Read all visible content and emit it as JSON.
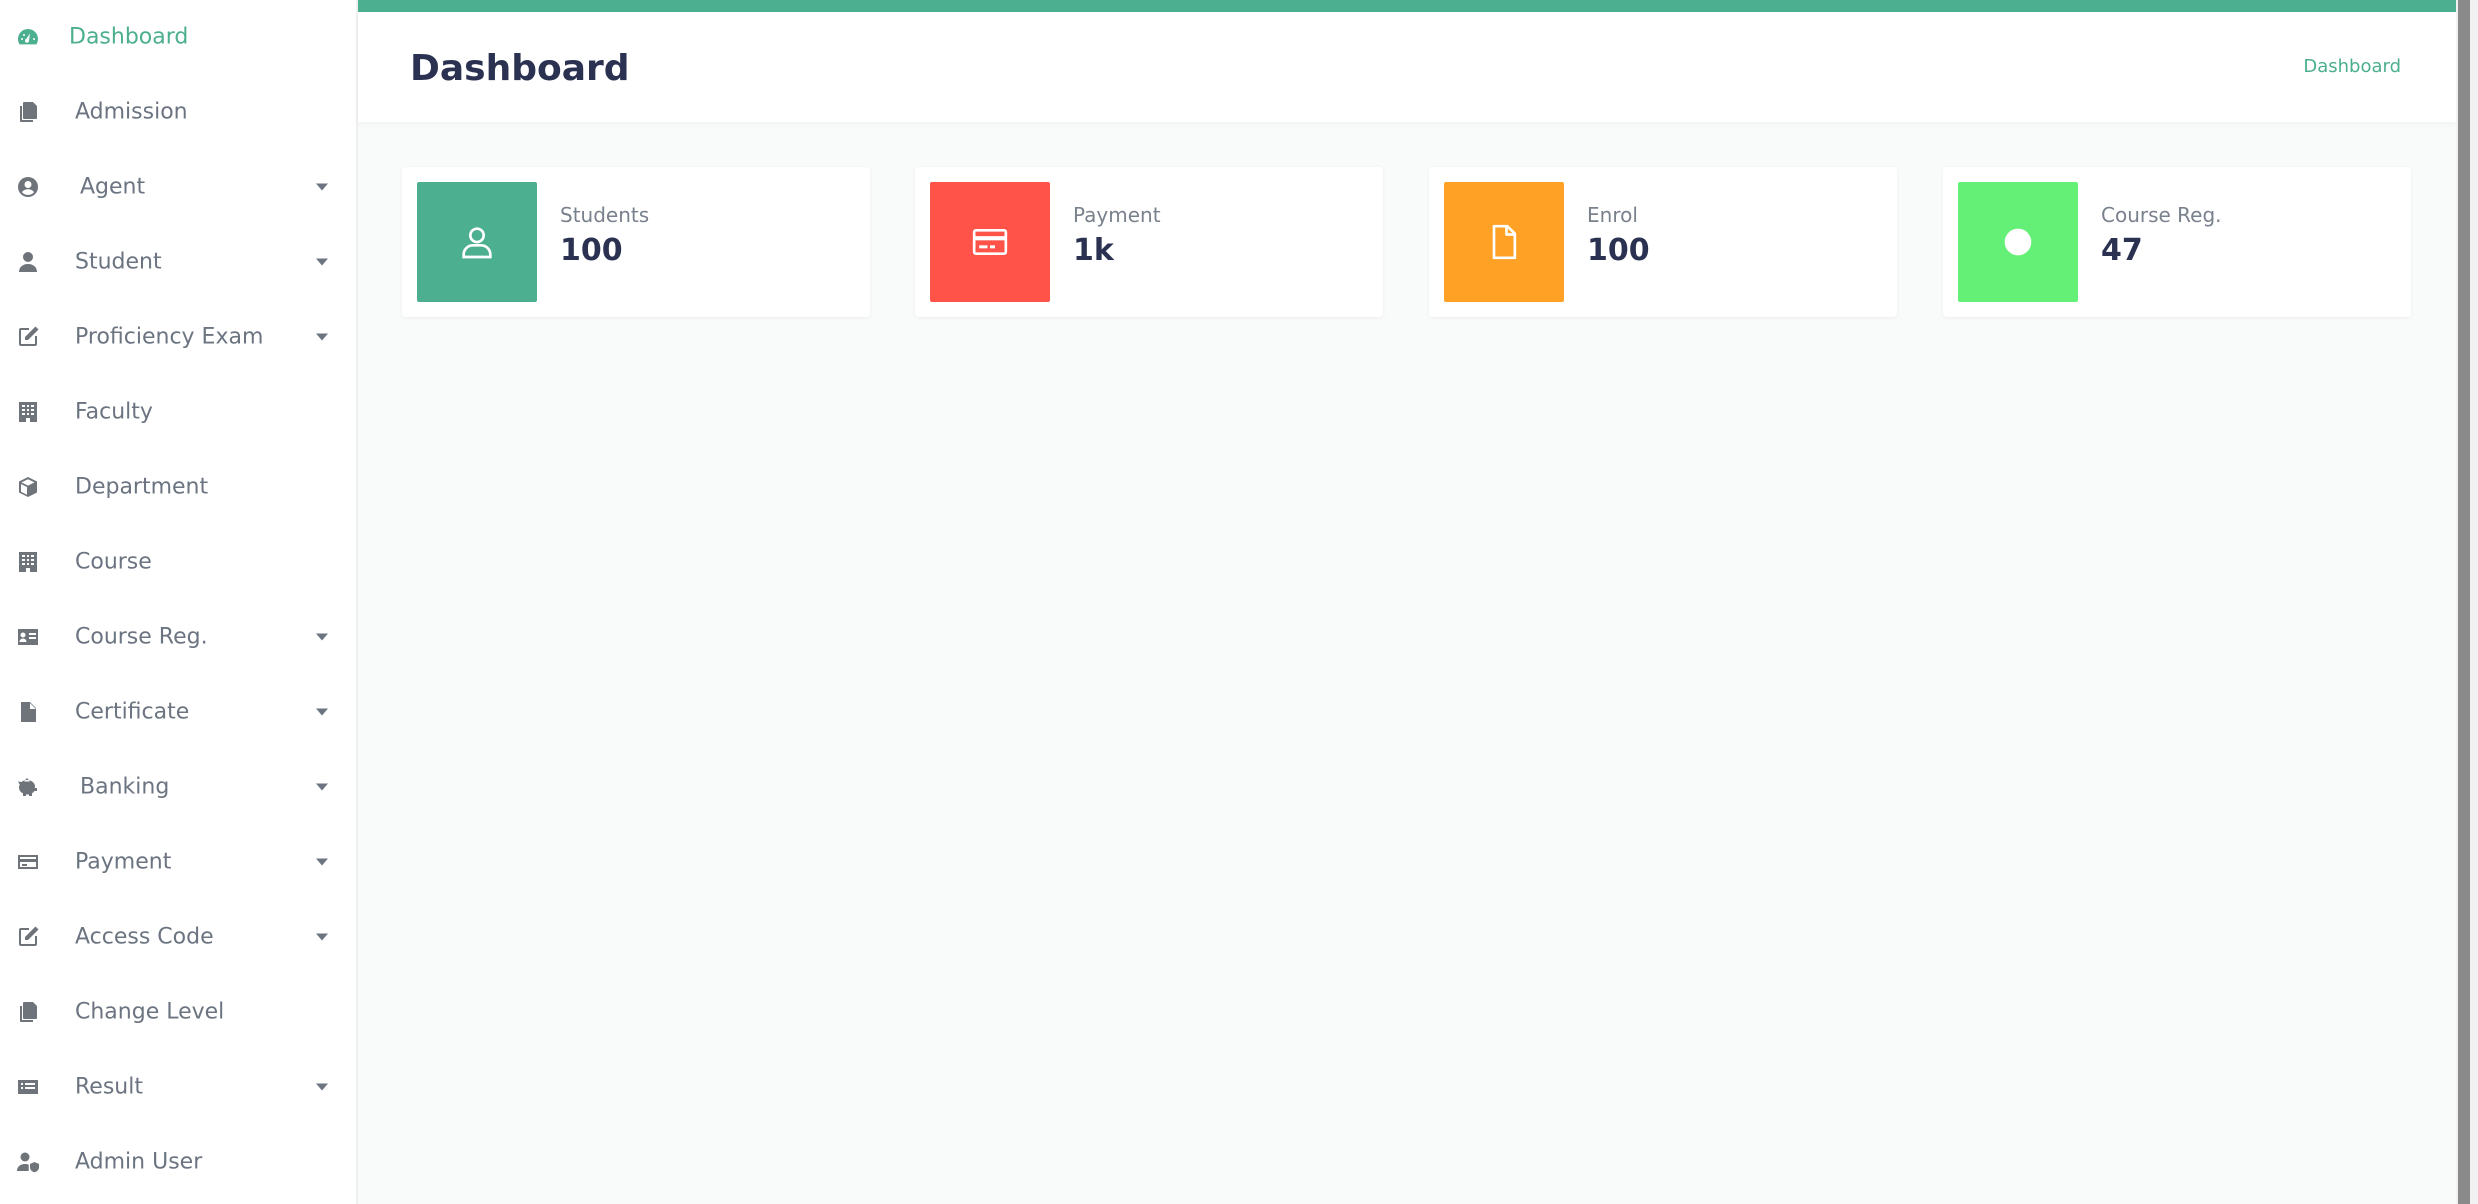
{
  "sidebar": {
    "items": [
      {
        "label": "Dashboard",
        "icon": "gauge-icon",
        "active": true,
        "caret": false
      },
      {
        "label": "Admission",
        "icon": "copy-icon",
        "caret": false
      },
      {
        "label": "Agent",
        "icon": "user-circle-icon",
        "caret": true
      },
      {
        "label": "Student",
        "icon": "user-icon",
        "caret": true
      },
      {
        "label": "Proficiency Exam",
        "icon": "edit-icon",
        "caret": true
      },
      {
        "label": "Faculty",
        "icon": "building-icon",
        "caret": false
      },
      {
        "label": "Department",
        "icon": "cube-icon",
        "caret": false
      },
      {
        "label": "Course",
        "icon": "building-icon",
        "caret": false
      },
      {
        "label": "Course Reg.",
        "icon": "id-card-icon",
        "caret": true
      },
      {
        "label": "Certificate",
        "icon": "file-icon",
        "caret": true
      },
      {
        "label": "Banking",
        "icon": "piggy-bank-icon",
        "caret": true
      },
      {
        "label": "Payment",
        "icon": "credit-card-icon",
        "caret": true
      },
      {
        "label": "Access Code",
        "icon": "edit-icon",
        "caret": true
      },
      {
        "label": "Change Level",
        "icon": "copy-icon",
        "caret": false
      },
      {
        "label": "Result",
        "icon": "list-card-icon",
        "caret": true
      },
      {
        "label": "Admin User",
        "icon": "user-shield-icon",
        "caret": false
      }
    ]
  },
  "header": {
    "title": "Dashboard",
    "breadcrumb": "Dashboard"
  },
  "cards": [
    {
      "label": "Students",
      "value": "100",
      "color": "#4caf8f",
      "icon": "user-outline-icon"
    },
    {
      "label": "Payment",
      "value": "1k",
      "color": "#ff5249",
      "icon": "credit-card-icon"
    },
    {
      "label": "Enrol",
      "value": "100",
      "color": "#ffa124",
      "icon": "file-outline-icon"
    },
    {
      "label": "Course Reg.",
      "value": "47",
      "color": "#64ef76",
      "icon": "circle-icon"
    }
  ],
  "colors": {
    "accent": "#4caf8f",
    "title": "#2b3150",
    "muted": "#6b7480"
  }
}
